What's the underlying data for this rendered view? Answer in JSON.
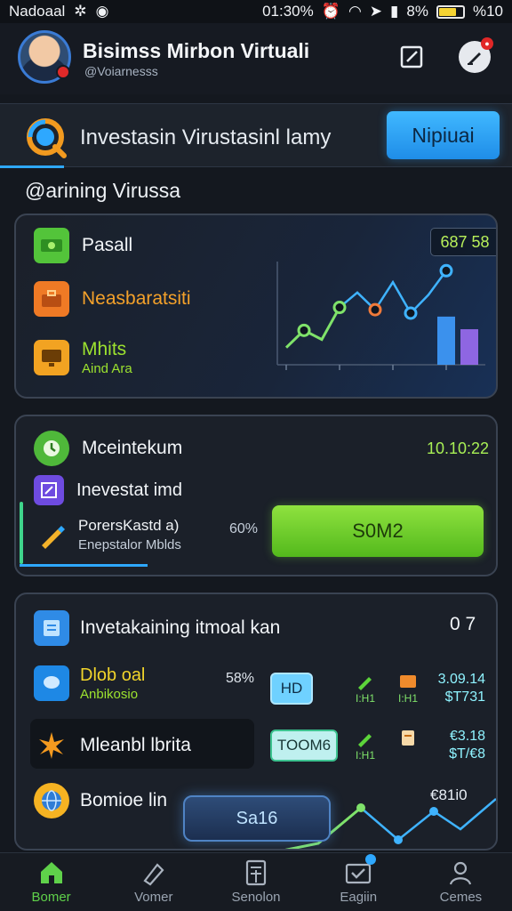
{
  "status_bar": {
    "carrier": "Nadoaal",
    "time": "01:30%",
    "battery_text": "8%",
    "signal_text": "%10",
    "battery_level": 0.75
  },
  "header": {
    "title": "Bisimss Mirbon Virtuali",
    "subtitle": "@Voiarnesss"
  },
  "search_bar": {
    "title": "Investasin Virustasinl lamy",
    "button_label": "Nipiuai"
  },
  "section_label": "@arining Virussa",
  "card1": {
    "value": "687 58",
    "items": [
      {
        "label": "Pasall",
        "style": "white",
        "icon": "green-bills-icon"
      },
      {
        "label": "Neasbaratsiti",
        "style": "orange",
        "icon": "orange-briefcase-icon"
      },
      {
        "label": "Mhits",
        "sub": "Aind Ara",
        "style": "green",
        "icon": "yellow-monitor-icon"
      }
    ],
    "chart": {
      "type": "line",
      "points": [
        1.5,
        3,
        2.2,
        5,
        6.3,
        4.8,
        7.2,
        4.5,
        6.1,
        8.2
      ],
      "bars": [
        4.2,
        3.1
      ]
    }
  },
  "card2": {
    "title": "Mceintekum",
    "time": "10.10:22",
    "row1": "Inevestat imd",
    "row2_title": "PorersKastd a)",
    "row2_sub": "Enepstalor Mblds",
    "percent": "60%",
    "button_label": "S0M2"
  },
  "card3": {
    "title": "Invetakaining itmoal kan",
    "count": "0 7",
    "row1": {
      "title": "Dlob oal",
      "sub": "Anbikosio",
      "percent": "58%",
      "chip": "HD",
      "mini1": "I:H1",
      "mini2": "I:H1",
      "num1": "3.09.14",
      "num2": "$T731"
    },
    "row2": {
      "title": "Mleanbl lbrita",
      "chip": "TOOM6",
      "mini1": "I:H1",
      "num1": "€3.18",
      "num2": "$T/€8"
    },
    "row3": {
      "title": "Bomioe lin",
      "num": "€81i0"
    },
    "sale_label": "Sa16"
  },
  "nav": [
    {
      "label": "Bomer",
      "icon": "home-icon",
      "active": true
    },
    {
      "label": "Vomer",
      "icon": "edit-pen-icon",
      "active": false
    },
    {
      "label": "Senolon",
      "icon": "calculator-icon",
      "active": false
    },
    {
      "label": "Eagiin",
      "icon": "check-mail-icon",
      "active": false
    },
    {
      "label": "Cemes",
      "icon": "profile-icon",
      "active": false
    }
  ],
  "colors": {
    "accent_blue": "#2ea8ff",
    "accent_green": "#8fe23f",
    "background": "#14181f"
  }
}
